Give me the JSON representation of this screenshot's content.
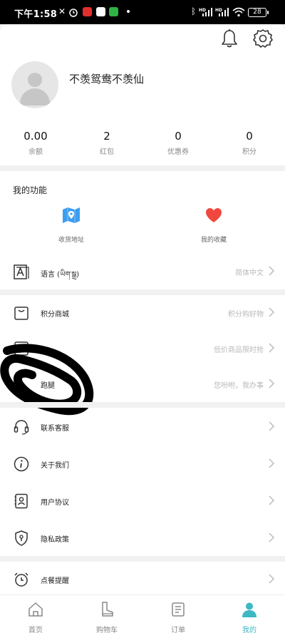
{
  "status_bar": {
    "time": "下午1:58",
    "signal_tag_1": "HD",
    "signal_tag_2": "HD",
    "battery": "28"
  },
  "user": {
    "name": "不羡鸳鸯不羡仙"
  },
  "stats": [
    {
      "value": "0.00",
      "label": "余额"
    },
    {
      "value": "2",
      "label": "红包"
    },
    {
      "value": "0",
      "label": "优惠券"
    },
    {
      "value": "0",
      "label": "积分"
    }
  ],
  "functions": {
    "title": "我的功能",
    "items": [
      {
        "label": "收货地址",
        "icon": "map-icon"
      },
      {
        "label": "我的收藏",
        "icon": "heart-icon"
      }
    ]
  },
  "language_row": {
    "label": "语言 (ཡིག་སྒྲ)",
    "hint": "简体中文"
  },
  "service_rows": [
    {
      "label": "积分商城",
      "hint": "积分购好物"
    },
    {
      "label": "",
      "hint": "低价商品限时抢"
    },
    {
      "label": "跑腿",
      "hint": "您吩咐，我办事"
    }
  ],
  "info_rows": [
    {
      "label": "联系客服"
    },
    {
      "label": "关于我们"
    },
    {
      "label": "用户协议"
    },
    {
      "label": "隐私政策"
    }
  ],
  "reminder_row": {
    "label": "点餐提醒"
  },
  "tabs": [
    {
      "label": "首页",
      "icon": "home-icon"
    },
    {
      "label": "购物车",
      "icon": "boot-icon"
    },
    {
      "label": "订单",
      "icon": "order-icon"
    },
    {
      "label": "我的",
      "icon": "profile-icon",
      "active": true
    }
  ],
  "colors": {
    "accent": "#3cb8c4",
    "map_blue": "#3d9df0",
    "heart_red": "#f0483e"
  }
}
